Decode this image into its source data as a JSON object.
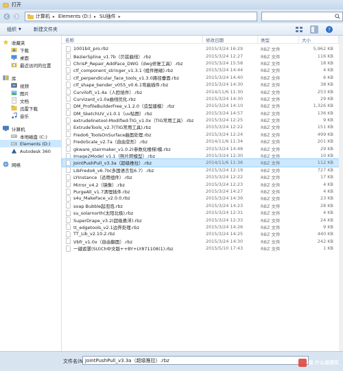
{
  "window": {
    "title": "打开"
  },
  "address": {
    "crumbs": [
      "计算机",
      "Elements (D:)",
      "SU插件"
    ]
  },
  "toolbar": {
    "organize": "组织",
    "new_folder": "新建文件夹"
  },
  "sidebar": {
    "favorites": {
      "label": "收藏夹",
      "items": [
        "下载",
        "桌面",
        "最近访问的位置"
      ]
    },
    "libraries": {
      "label": "库",
      "items": [
        "视频",
        "图片",
        "文档",
        "迅雷下载",
        "音乐"
      ]
    },
    "computer": {
      "label": "计算机",
      "items": [
        "本地磁盘 (C:)",
        "Elements (D:)",
        "Autodesk 360"
      ]
    },
    "network": {
      "label": "网络"
    }
  },
  "columns": {
    "name": "名称",
    "date": "修改日期",
    "type": "类型",
    "size": "大小"
  },
  "files": [
    {
      "name": "1001bit_pro.rbz",
      "date": "2015/3/24 16:29",
      "type": "RBZ 文件",
      "size": "5,962 KB"
    },
    {
      "name": "BezierSpline_v1.7b（贝兹曲线）.rbz",
      "date": "2015/3/24 12:27",
      "type": "RBZ 文件",
      "size": "116 KB"
    },
    {
      "name": "ChrisP_Repair_AddFace_DWG（dwg修复工具）.rbz",
      "date": "2015/3/24 15:58",
      "type": "RBZ 文件",
      "size": "18 KB"
    },
    {
      "name": "clf_component_stringer_v1.3.1 (组件推磁).rbz",
      "date": "2015/3/24 14:44",
      "type": "RBZ 文件",
      "size": "4 KB"
    },
    {
      "name": "clf_perpendicular_face_tools_v1.3.0路径垂面.rbz",
      "date": "2015/3/24 14:40",
      "type": "RBZ 文件",
      "size": "6 KB"
    },
    {
      "name": "clf_shape_bender_v055_v0.6.1弯曲插件.rbz",
      "date": "2015/3/24 14:30",
      "type": "RBZ 文件",
      "size": "38 KB"
    },
    {
      "name": "Curviloft_v1.4a（人脸插件）.rbz",
      "date": "2014/11/6 11:30",
      "type": "RBZ 文件",
      "size": "253 KB"
    },
    {
      "name": "Curvizard_v1.0a曲线优化.rbz",
      "date": "2015/3/24 14:30",
      "type": "RBZ 文件",
      "size": "29 KB"
    },
    {
      "name": "DM_ProfileBuilderFree_v.1.2.0（造型建模）.rbz",
      "date": "2015/3/24 14:10",
      "type": "RBZ 文件",
      "size": "1,326 KB"
    },
    {
      "name": "DM_SketchUV_v1.0.1（uv贴图）.rbz",
      "date": "2015/3/24 14:57",
      "type": "RBZ 文件",
      "size": "136 KB"
    },
    {
      "name": "extrudelinetool-Modified-TIG_v1.0x（TIG常用工具）.rbz",
      "date": "2015/3/24 12:25",
      "type": "RBZ 文件",
      "size": "9 KB"
    },
    {
      "name": "ExtrudeTools_v2.7(TIG常用工具).rbz",
      "date": "2015/3/24 12:22",
      "type": "RBZ 文件",
      "size": "151 KB"
    },
    {
      "name": "Fredo6_ToolsOnSurface曲面处理.rbz",
      "date": "2015/3/24 12:24",
      "type": "RBZ 文件",
      "size": "499 KB"
    },
    {
      "name": "FredoScale_v2.7a（自由变形）.rbz",
      "date": "2014/11/6 11:34",
      "type": "RBZ 文件",
      "size": "201 KB"
    },
    {
      "name": "gkware_stairmaker_v1.0.2(参数化楼梯)模.rbz",
      "date": "2015/3/24 14:48",
      "type": "RBZ 文件",
      "size": "29 KB"
    },
    {
      "name": "Image2Model_v1.1（照片转模型）.rbz",
      "date": "2015/3/24 12:30",
      "type": "RBZ 文件",
      "size": "10 KB"
    },
    {
      "name": "JointPushPull_v3.3a（超级推拉）.rbz",
      "date": "2014/11/6 11:36",
      "type": "RBZ 文件",
      "size": "112 KB",
      "selected": true
    },
    {
      "name": "LibFredo6_v6.7b(多国语言包6.7）.rbz",
      "date": "2015/3/24 12:19",
      "type": "RBZ 文件",
      "size": "727 KB"
    },
    {
      "name": "LYInstance（适用组件）.rbz",
      "date": "2015/3/24 12:22",
      "type": "RBZ 文件",
      "size": "17 KB"
    },
    {
      "name": "Mirror_v4.2（镜像）.rbz",
      "date": "2015/3/24 12:23",
      "type": "RBZ 文件",
      "size": "4 KB"
    },
    {
      "name": "PurgeAll_v1.7清理插件.rbz",
      "date": "2015/3/24 14:27",
      "type": "RBZ 文件",
      "size": "4 KB"
    },
    {
      "name": "s4u_MakeFace_v2.0.0.rbz",
      "date": "2015/3/24 14:39",
      "type": "RBZ 文件",
      "size": "23 KB"
    },
    {
      "name": "soap Bubble起泡泡.rbz",
      "date": "2015/3/24 14:23",
      "type": "RBZ 文件",
      "size": "28 KB"
    },
    {
      "name": "su_solarnorth(太阳北极).rbz",
      "date": "2015/3/24 12:31",
      "type": "RBZ 文件",
      "size": "4 KB"
    },
    {
      "name": "SuperDrape_v3.2(超级悬浮).rbz",
      "date": "2015/3/24 12:33",
      "type": "RBZ 文件",
      "size": "24 KB"
    },
    {
      "name": "tt_edgetools_v2.1边界处理.rbz",
      "date": "2015/3/24 14:26",
      "type": "RBZ 文件",
      "size": "9 KB"
    },
    {
      "name": "TT_Lib_v2.10.2.rbz",
      "date": "2015/3/24 14:25",
      "type": "RBZ 文件",
      "size": "440 KB"
    },
    {
      "name": "Vbfr_v1.0x（自由翻面）.rbz",
      "date": "2015/3/24 14:30",
      "type": "RBZ 文件",
      "size": "242 KB"
    },
    {
      "name": "一键遮罩(SU)Ch中文版++BY+LY871108(1).rbz",
      "date": "2015/5/10 17:43",
      "type": "RBZ 文件",
      "size": "1 KB"
    }
  ],
  "footer": {
    "filename_label": "文件名(N):",
    "filename_value": "JointPushPull_v3.3a（超级推拉）.rbz"
  },
  "watermark": {
    "text": "值 什么值得买"
  },
  "colors": {
    "selection": "#cce8ff",
    "chrome": "#d8e4f1"
  }
}
